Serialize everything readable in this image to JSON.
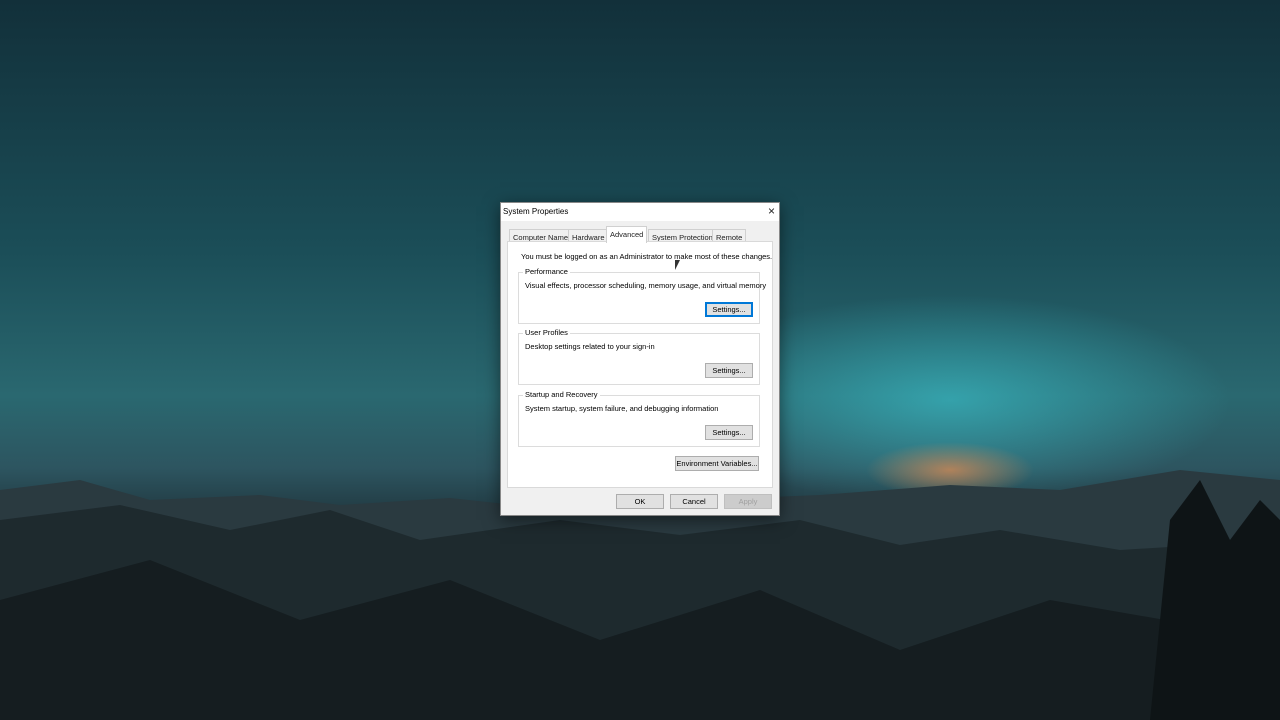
{
  "dialog": {
    "title": "System Properties",
    "tabs": [
      "Computer Name",
      "Hardware",
      "Advanced",
      "System Protection",
      "Remote"
    ],
    "active_tab": "Advanced",
    "note": "You must be logged on as an Administrator to make most of these changes.",
    "groups": [
      {
        "label": "Performance",
        "description": "Visual effects, processor scheduling, memory usage, and virtual memory",
        "button": "Settings..."
      },
      {
        "label": "User Profiles",
        "description": "Desktop settings related to your sign-in",
        "button": "Settings..."
      },
      {
        "label": "Startup and Recovery",
        "description": "System startup, system failure, and debugging information",
        "button": "Settings..."
      }
    ],
    "env_button": "Environment Variables...",
    "ok": "OK",
    "cancel": "Cancel",
    "apply": "Apply",
    "close_icon": "×"
  }
}
